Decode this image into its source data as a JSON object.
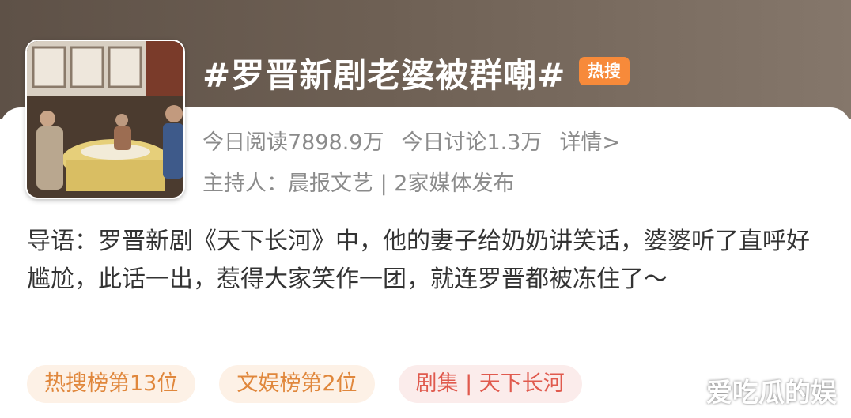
{
  "topic": {
    "title": "#罗晋新剧老婆被群嘲#",
    "badge": "热搜",
    "thumbnail_icon": "drama-scene-thumbnail"
  },
  "stats": {
    "reads": "今日阅读7898.9万",
    "discussions": "今日讨论1.3万",
    "details_link": "详情>"
  },
  "host": "主持人：晨报文艺 | 2家媒体发布",
  "intro": "导语：罗晋新剧《天下长河》中，他的妻子给奶奶讲笑话，婆婆听了直呼好尴尬，此话一出，惹得大家笑作一团，就连罗晋都被冻住了～",
  "tags": [
    {
      "label": "热搜榜第13位",
      "color": "#e0873c"
    },
    {
      "label": "文娱榜第2位",
      "color": "#e0873c"
    },
    {
      "label": "剧集 | 天下长河",
      "color": "#e05a4e"
    }
  ],
  "watermark": "爱吃瓜的娱"
}
